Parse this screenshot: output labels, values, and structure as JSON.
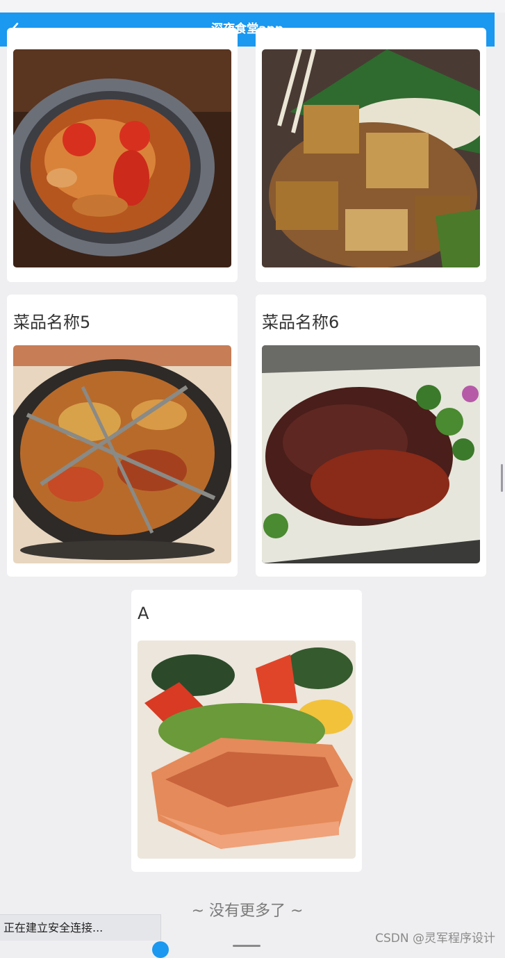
{
  "navbar": {
    "title": "深夜食堂app",
    "back_icon": "chevron-left-icon"
  },
  "dishes": [
    {
      "name": "",
      "image": "braised crab dish in metal pot"
    },
    {
      "name": "",
      "image": "grilled tofu with sesame on banana leaf"
    },
    {
      "name": "菜品名称5",
      "image": "nine-grid spicy hotpot"
    },
    {
      "name": "菜品名称6",
      "image": "sliced braised meat in red sauce on plate"
    },
    {
      "name": "A",
      "image": "grilled salmon with tomato salad"
    }
  ],
  "footer": {
    "no_more": "~ 没有更多了 ~"
  },
  "browser_status": {
    "text": "正在建立安全连接..."
  },
  "watermark": "CSDN @灵军程序设计",
  "colors": {
    "accent": "#1b98f0",
    "background": "#efeff1",
    "card": "#ffffff"
  }
}
